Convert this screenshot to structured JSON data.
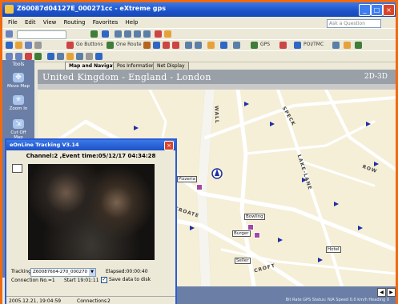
{
  "window": {
    "title": "Z60087d04127E_000271cc - eXtreme gps"
  },
  "menu": [
    "File",
    "Edit",
    "View",
    "Routing",
    "Favorites",
    "Help"
  ],
  "ask_placeholder": "Ask a Question",
  "toolbar": {
    "buttons_label": "Go Buttons",
    "route_label": "One Route",
    "satellite_label": "GPS",
    "poi_label": "POI/TMC"
  },
  "sidebar": {
    "title": "Tools",
    "items": [
      "Move Map",
      "Zoom In",
      "Cut Off Map"
    ]
  },
  "tabs": [
    "Map and Navigation",
    "Pos Information",
    "Net Display"
  ],
  "map": {
    "location": "United Kingdom  -  England  -  London",
    "dim_toggle": "2D-3D",
    "streets": [
      "WALL",
      "SPECK",
      "LAKE-LANE",
      "CROATE",
      "CROFT",
      "ROW"
    ],
    "pois": [
      "Pizzeria",
      "Bowling",
      "Burger",
      "Seller",
      "Hotel"
    ]
  },
  "dialog": {
    "title": "eOnLine Tracking V3.14",
    "channel_info": "Channel:2 ,Event time:05/12/17 04:34:28",
    "tracking_label": "Tracking",
    "tracking_value": "Z60087604-270_000270",
    "elapsed": "Elapsed:00:00:40",
    "connection": "Connection No.=1",
    "start": "Start 19:01:11",
    "save_label": "Save data to disk",
    "status_date": "2005.12.21, 19:04:59",
    "status_connections_label": "Connections",
    "status_connections_value": "2"
  },
  "statusbar": {
    "text": "Bit Rate  GPS Status: N/A  Speed 0.0 km/h  Heading 0"
  }
}
